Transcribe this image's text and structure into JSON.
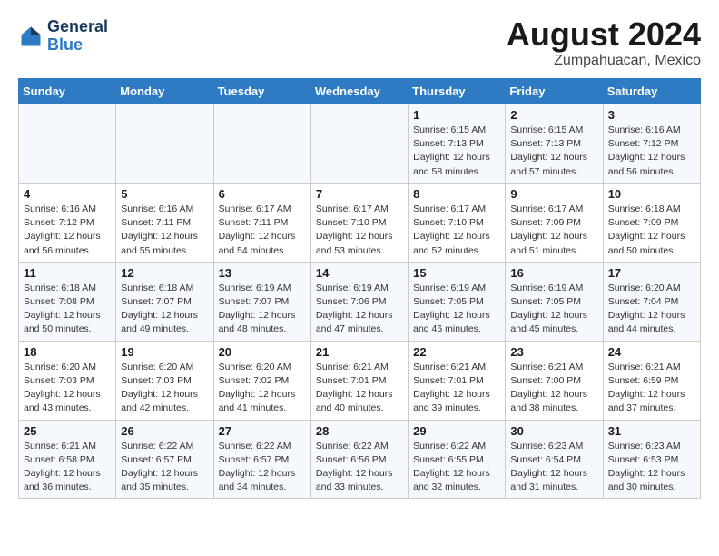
{
  "header": {
    "logo_line1": "General",
    "logo_line2": "Blue",
    "month_year": "August 2024",
    "location": "Zumpahuacan, Mexico"
  },
  "days_of_week": [
    "Sunday",
    "Monday",
    "Tuesday",
    "Wednesday",
    "Thursday",
    "Friday",
    "Saturday"
  ],
  "weeks": [
    [
      {
        "day": "",
        "info": ""
      },
      {
        "day": "",
        "info": ""
      },
      {
        "day": "",
        "info": ""
      },
      {
        "day": "",
        "info": ""
      },
      {
        "day": "1",
        "info": "Sunrise: 6:15 AM\nSunset: 7:13 PM\nDaylight: 12 hours\nand 58 minutes."
      },
      {
        "day": "2",
        "info": "Sunrise: 6:15 AM\nSunset: 7:13 PM\nDaylight: 12 hours\nand 57 minutes."
      },
      {
        "day": "3",
        "info": "Sunrise: 6:16 AM\nSunset: 7:12 PM\nDaylight: 12 hours\nand 56 minutes."
      }
    ],
    [
      {
        "day": "4",
        "info": "Sunrise: 6:16 AM\nSunset: 7:12 PM\nDaylight: 12 hours\nand 56 minutes."
      },
      {
        "day": "5",
        "info": "Sunrise: 6:16 AM\nSunset: 7:11 PM\nDaylight: 12 hours\nand 55 minutes."
      },
      {
        "day": "6",
        "info": "Sunrise: 6:17 AM\nSunset: 7:11 PM\nDaylight: 12 hours\nand 54 minutes."
      },
      {
        "day": "7",
        "info": "Sunrise: 6:17 AM\nSunset: 7:10 PM\nDaylight: 12 hours\nand 53 minutes."
      },
      {
        "day": "8",
        "info": "Sunrise: 6:17 AM\nSunset: 7:10 PM\nDaylight: 12 hours\nand 52 minutes."
      },
      {
        "day": "9",
        "info": "Sunrise: 6:17 AM\nSunset: 7:09 PM\nDaylight: 12 hours\nand 51 minutes."
      },
      {
        "day": "10",
        "info": "Sunrise: 6:18 AM\nSunset: 7:09 PM\nDaylight: 12 hours\nand 50 minutes."
      }
    ],
    [
      {
        "day": "11",
        "info": "Sunrise: 6:18 AM\nSunset: 7:08 PM\nDaylight: 12 hours\nand 50 minutes."
      },
      {
        "day": "12",
        "info": "Sunrise: 6:18 AM\nSunset: 7:07 PM\nDaylight: 12 hours\nand 49 minutes."
      },
      {
        "day": "13",
        "info": "Sunrise: 6:19 AM\nSunset: 7:07 PM\nDaylight: 12 hours\nand 48 minutes."
      },
      {
        "day": "14",
        "info": "Sunrise: 6:19 AM\nSunset: 7:06 PM\nDaylight: 12 hours\nand 47 minutes."
      },
      {
        "day": "15",
        "info": "Sunrise: 6:19 AM\nSunset: 7:05 PM\nDaylight: 12 hours\nand 46 minutes."
      },
      {
        "day": "16",
        "info": "Sunrise: 6:19 AM\nSunset: 7:05 PM\nDaylight: 12 hours\nand 45 minutes."
      },
      {
        "day": "17",
        "info": "Sunrise: 6:20 AM\nSunset: 7:04 PM\nDaylight: 12 hours\nand 44 minutes."
      }
    ],
    [
      {
        "day": "18",
        "info": "Sunrise: 6:20 AM\nSunset: 7:03 PM\nDaylight: 12 hours\nand 43 minutes."
      },
      {
        "day": "19",
        "info": "Sunrise: 6:20 AM\nSunset: 7:03 PM\nDaylight: 12 hours\nand 42 minutes."
      },
      {
        "day": "20",
        "info": "Sunrise: 6:20 AM\nSunset: 7:02 PM\nDaylight: 12 hours\nand 41 minutes."
      },
      {
        "day": "21",
        "info": "Sunrise: 6:21 AM\nSunset: 7:01 PM\nDaylight: 12 hours\nand 40 minutes."
      },
      {
        "day": "22",
        "info": "Sunrise: 6:21 AM\nSunset: 7:01 PM\nDaylight: 12 hours\nand 39 minutes."
      },
      {
        "day": "23",
        "info": "Sunrise: 6:21 AM\nSunset: 7:00 PM\nDaylight: 12 hours\nand 38 minutes."
      },
      {
        "day": "24",
        "info": "Sunrise: 6:21 AM\nSunset: 6:59 PM\nDaylight: 12 hours\nand 37 minutes."
      }
    ],
    [
      {
        "day": "25",
        "info": "Sunrise: 6:21 AM\nSunset: 6:58 PM\nDaylight: 12 hours\nand 36 minutes."
      },
      {
        "day": "26",
        "info": "Sunrise: 6:22 AM\nSunset: 6:57 PM\nDaylight: 12 hours\nand 35 minutes."
      },
      {
        "day": "27",
        "info": "Sunrise: 6:22 AM\nSunset: 6:57 PM\nDaylight: 12 hours\nand 34 minutes."
      },
      {
        "day": "28",
        "info": "Sunrise: 6:22 AM\nSunset: 6:56 PM\nDaylight: 12 hours\nand 33 minutes."
      },
      {
        "day": "29",
        "info": "Sunrise: 6:22 AM\nSunset: 6:55 PM\nDaylight: 12 hours\nand 32 minutes."
      },
      {
        "day": "30",
        "info": "Sunrise: 6:23 AM\nSunset: 6:54 PM\nDaylight: 12 hours\nand 31 minutes."
      },
      {
        "day": "31",
        "info": "Sunrise: 6:23 AM\nSunset: 6:53 PM\nDaylight: 12 hours\nand 30 minutes."
      }
    ]
  ]
}
